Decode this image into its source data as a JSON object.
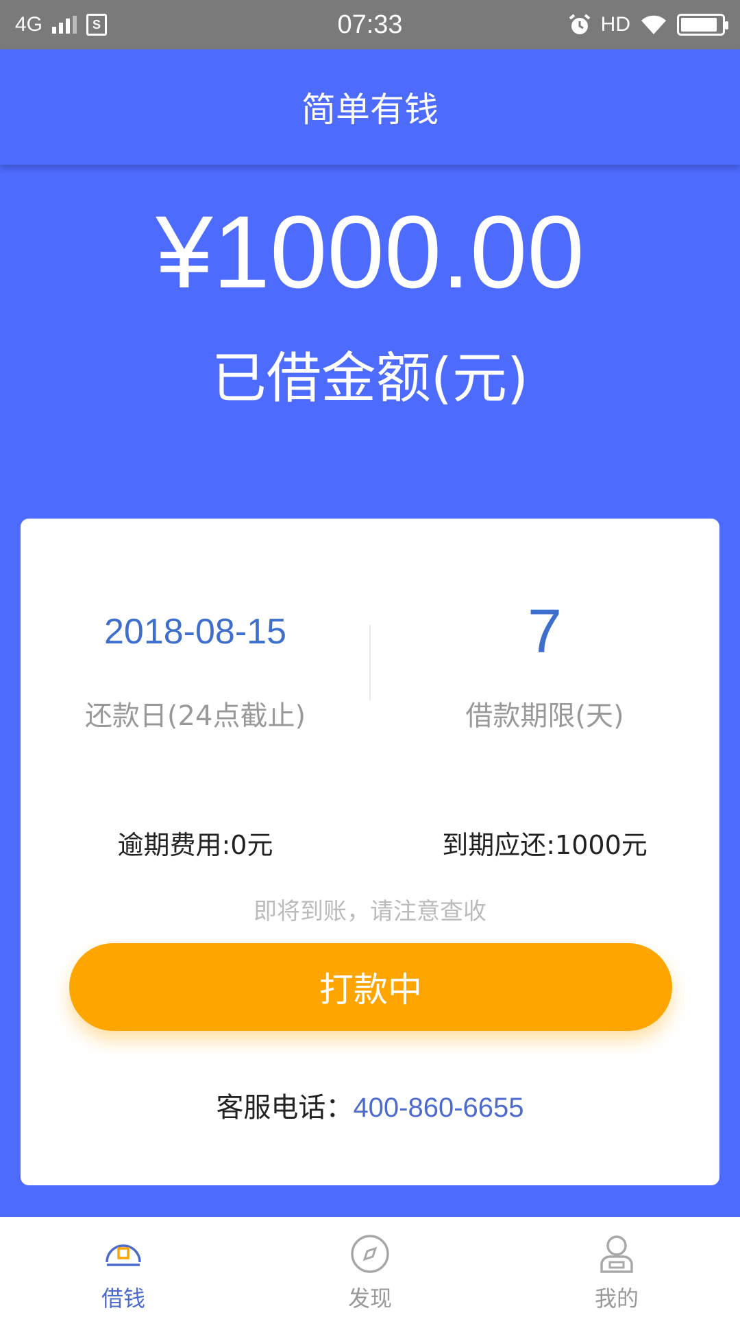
{
  "status_bar": {
    "network": "4G",
    "time": "07:33",
    "hd": "HD"
  },
  "header": {
    "title": "简单有钱"
  },
  "loan": {
    "amount": "¥1000.00",
    "amount_label": "已借金额(元)"
  },
  "details": {
    "repay_date": "2018-08-15",
    "repay_date_label": "还款日(24点截止)",
    "term_days": "7",
    "term_label": "借款期限(天)",
    "overdue_fee": "逾期费用:0元",
    "due_amount": "到期应还:1000元",
    "notice": "即将到账，请注意查收",
    "button_label": "打款中",
    "service_label": "客服电话：",
    "service_phone": "400-860-6655"
  },
  "tabs": [
    {
      "label": "借钱",
      "icon": "wallet-icon",
      "active": true
    },
    {
      "label": "发现",
      "icon": "compass-icon",
      "active": false
    },
    {
      "label": "我的",
      "icon": "user-icon",
      "active": false
    }
  ],
  "colors": {
    "primary": "#4D6BFE",
    "accent": "#FFA500",
    "value_blue": "#3E6FCC",
    "status_bar": "#7A7A7A"
  }
}
